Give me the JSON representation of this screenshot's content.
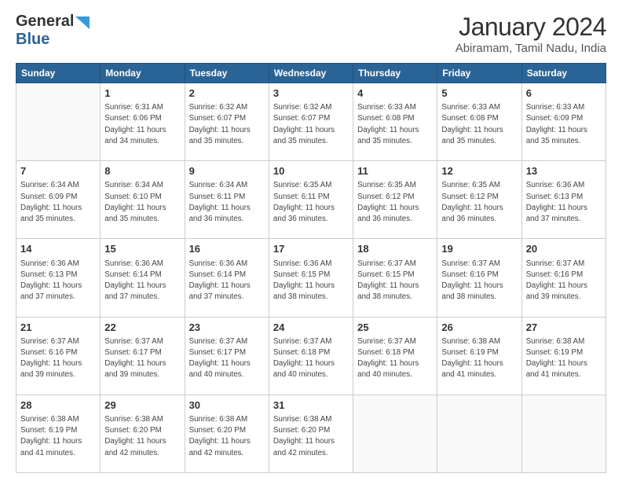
{
  "header": {
    "logo_line1": "General",
    "logo_line2": "Blue",
    "main_title": "January 2024",
    "sub_title": "Abiramam, Tamil Nadu, India"
  },
  "calendar": {
    "days_of_week": [
      "Sunday",
      "Monday",
      "Tuesday",
      "Wednesday",
      "Thursday",
      "Friday",
      "Saturday"
    ],
    "weeks": [
      [
        {
          "day": "",
          "info": ""
        },
        {
          "day": "1",
          "info": "Sunrise: 6:31 AM\nSunset: 6:06 PM\nDaylight: 11 hours\nand 34 minutes."
        },
        {
          "day": "2",
          "info": "Sunrise: 6:32 AM\nSunset: 6:07 PM\nDaylight: 11 hours\nand 35 minutes."
        },
        {
          "day": "3",
          "info": "Sunrise: 6:32 AM\nSunset: 6:07 PM\nDaylight: 11 hours\nand 35 minutes."
        },
        {
          "day": "4",
          "info": "Sunrise: 6:33 AM\nSunset: 6:08 PM\nDaylight: 11 hours\nand 35 minutes."
        },
        {
          "day": "5",
          "info": "Sunrise: 6:33 AM\nSunset: 6:08 PM\nDaylight: 11 hours\nand 35 minutes."
        },
        {
          "day": "6",
          "info": "Sunrise: 6:33 AM\nSunset: 6:09 PM\nDaylight: 11 hours\nand 35 minutes."
        }
      ],
      [
        {
          "day": "7",
          "info": "Sunrise: 6:34 AM\nSunset: 6:09 PM\nDaylight: 11 hours\nand 35 minutes."
        },
        {
          "day": "8",
          "info": "Sunrise: 6:34 AM\nSunset: 6:10 PM\nDaylight: 11 hours\nand 35 minutes."
        },
        {
          "day": "9",
          "info": "Sunrise: 6:34 AM\nSunset: 6:11 PM\nDaylight: 11 hours\nand 36 minutes."
        },
        {
          "day": "10",
          "info": "Sunrise: 6:35 AM\nSunset: 6:11 PM\nDaylight: 11 hours\nand 36 minutes."
        },
        {
          "day": "11",
          "info": "Sunrise: 6:35 AM\nSunset: 6:12 PM\nDaylight: 11 hours\nand 36 minutes."
        },
        {
          "day": "12",
          "info": "Sunrise: 6:35 AM\nSunset: 6:12 PM\nDaylight: 11 hours\nand 36 minutes."
        },
        {
          "day": "13",
          "info": "Sunrise: 6:36 AM\nSunset: 6:13 PM\nDaylight: 11 hours\nand 37 minutes."
        }
      ],
      [
        {
          "day": "14",
          "info": "Sunrise: 6:36 AM\nSunset: 6:13 PM\nDaylight: 11 hours\nand 37 minutes."
        },
        {
          "day": "15",
          "info": "Sunrise: 6:36 AM\nSunset: 6:14 PM\nDaylight: 11 hours\nand 37 minutes."
        },
        {
          "day": "16",
          "info": "Sunrise: 6:36 AM\nSunset: 6:14 PM\nDaylight: 11 hours\nand 37 minutes."
        },
        {
          "day": "17",
          "info": "Sunrise: 6:36 AM\nSunset: 6:15 PM\nDaylight: 11 hours\nand 38 minutes."
        },
        {
          "day": "18",
          "info": "Sunrise: 6:37 AM\nSunset: 6:15 PM\nDaylight: 11 hours\nand 38 minutes."
        },
        {
          "day": "19",
          "info": "Sunrise: 6:37 AM\nSunset: 6:16 PM\nDaylight: 11 hours\nand 38 minutes."
        },
        {
          "day": "20",
          "info": "Sunrise: 6:37 AM\nSunset: 6:16 PM\nDaylight: 11 hours\nand 39 minutes."
        }
      ],
      [
        {
          "day": "21",
          "info": "Sunrise: 6:37 AM\nSunset: 6:16 PM\nDaylight: 11 hours\nand 39 minutes."
        },
        {
          "day": "22",
          "info": "Sunrise: 6:37 AM\nSunset: 6:17 PM\nDaylight: 11 hours\nand 39 minutes."
        },
        {
          "day": "23",
          "info": "Sunrise: 6:37 AM\nSunset: 6:17 PM\nDaylight: 11 hours\nand 40 minutes."
        },
        {
          "day": "24",
          "info": "Sunrise: 6:37 AM\nSunset: 6:18 PM\nDaylight: 11 hours\nand 40 minutes."
        },
        {
          "day": "25",
          "info": "Sunrise: 6:37 AM\nSunset: 6:18 PM\nDaylight: 11 hours\nand 40 minutes."
        },
        {
          "day": "26",
          "info": "Sunrise: 6:38 AM\nSunset: 6:19 PM\nDaylight: 11 hours\nand 41 minutes."
        },
        {
          "day": "27",
          "info": "Sunrise: 6:38 AM\nSunset: 6:19 PM\nDaylight: 11 hours\nand 41 minutes."
        }
      ],
      [
        {
          "day": "28",
          "info": "Sunrise: 6:38 AM\nSunset: 6:19 PM\nDaylight: 11 hours\nand 41 minutes."
        },
        {
          "day": "29",
          "info": "Sunrise: 6:38 AM\nSunset: 6:20 PM\nDaylight: 11 hours\nand 42 minutes."
        },
        {
          "day": "30",
          "info": "Sunrise: 6:38 AM\nSunset: 6:20 PM\nDaylight: 11 hours\nand 42 minutes."
        },
        {
          "day": "31",
          "info": "Sunrise: 6:38 AM\nSunset: 6:20 PM\nDaylight: 11 hours\nand 42 minutes."
        },
        {
          "day": "",
          "info": ""
        },
        {
          "day": "",
          "info": ""
        },
        {
          "day": "",
          "info": ""
        }
      ]
    ]
  }
}
